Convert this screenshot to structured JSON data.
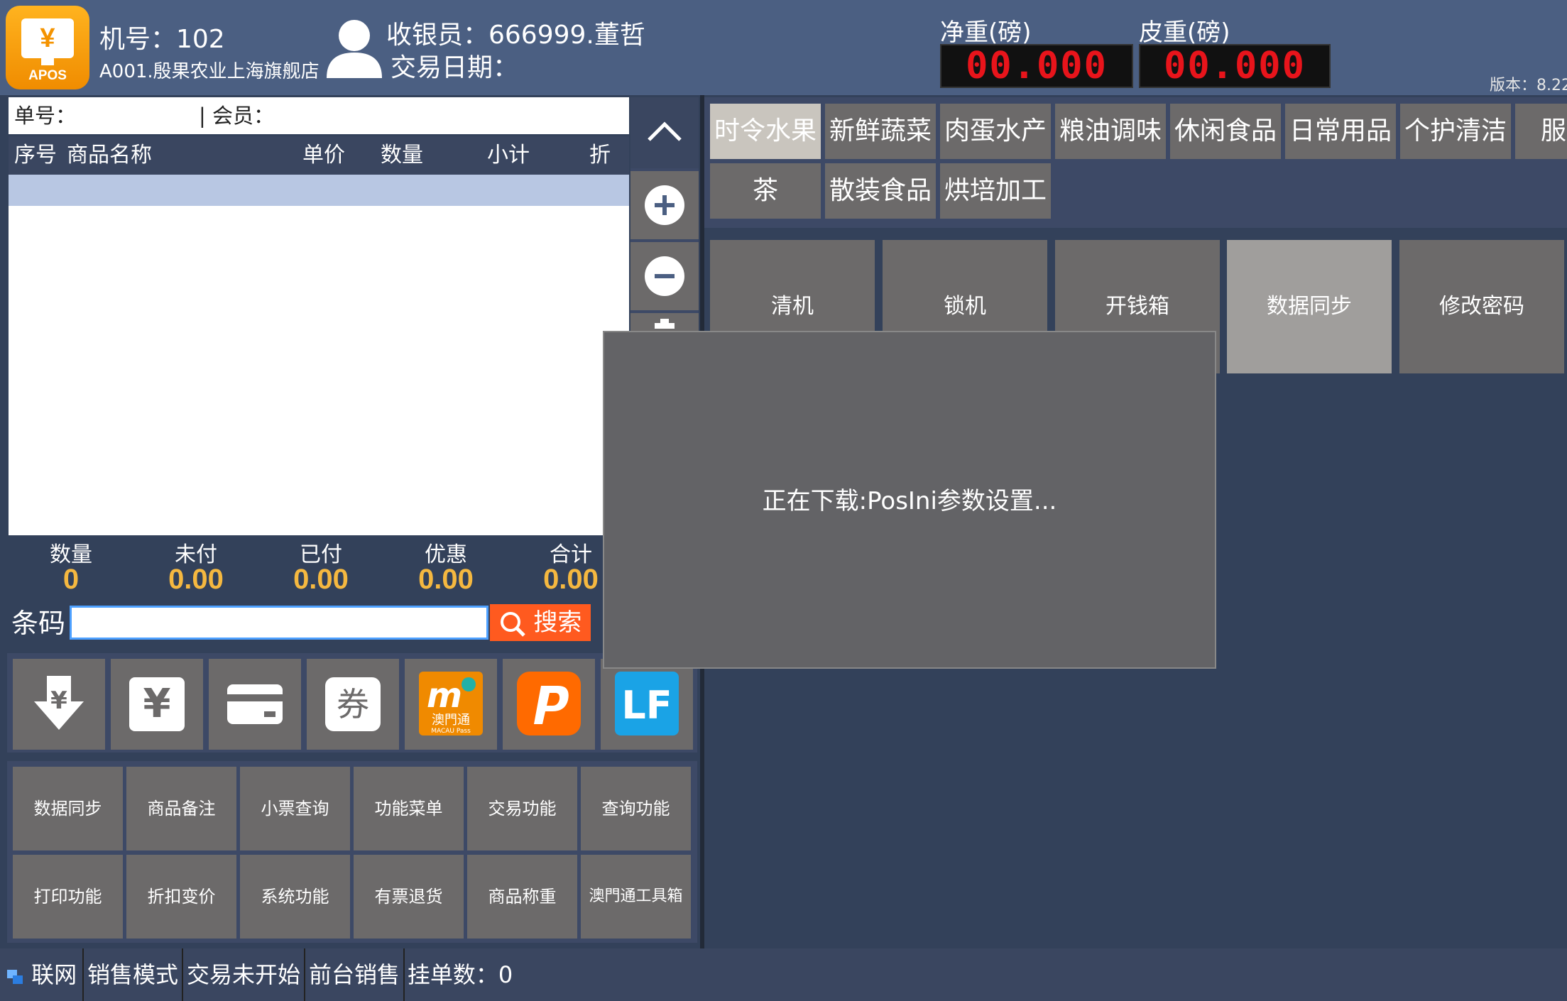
{
  "header": {
    "logo_text": "APOS",
    "logo_symbol": "¥",
    "machine_label": "机号：102",
    "store_label": "A001.殷果农业上海旗舰店",
    "cashier_label": "收银员：666999.董哲",
    "trade_date_label": "交易日期：",
    "net_weight_label": "净重(磅)",
    "tare_weight_label": "皮重(磅)",
    "net_weight_value": "00.000",
    "tare_weight_value": "00.000",
    "version_label": "版本：8.22"
  },
  "order": {
    "order_no_label": "单号：",
    "member_label": "| 会员："
  },
  "table": {
    "columns": [
      "序号",
      "商品名称",
      "单价",
      "数量",
      "小计",
      "折扣"
    ]
  },
  "summary": [
    {
      "label": "数量",
      "value": "0"
    },
    {
      "label": "未付",
      "value": "0.00"
    },
    {
      "label": "已付",
      "value": "0.00"
    },
    {
      "label": "优惠",
      "value": "0.00"
    },
    {
      "label": "合计",
      "value": "0.00"
    }
  ],
  "barcode": {
    "label": "条码",
    "value": "",
    "search_label": "搜索"
  },
  "payments": [
    "¥↓",
    "¥",
    "card",
    "券",
    "MACAU Pass",
    "P",
    "LF"
  ],
  "payment_texts": {
    "coupon": "券",
    "macau_main": "m",
    "macau_cn": "澳門通",
    "macau_en": "MACAU Pass",
    "lf": "LF"
  },
  "functions_row1": [
    "数据同步",
    "商品备注",
    "小票查询",
    "功能菜单",
    "交易功能",
    "查询功能"
  ],
  "functions_row2": [
    "打印功能",
    "折扣变价",
    "系统功能",
    "有票退货",
    "商品称重",
    "澳門通工具箱"
  ],
  "categories_row1": [
    "时令水果",
    "新鲜蔬菜",
    "肉蛋水产",
    "粮油调味",
    "休闲食品",
    "日常用品",
    "个护清洁",
    "服"
  ],
  "categories_row2": [
    "茶",
    "散装食品",
    "烘培加工"
  ],
  "function_tiles": [
    "清机",
    "锁机",
    "开钱箱",
    "数据同步",
    "修改密码"
  ],
  "dialog": {
    "message": "正在下载:PosIni参数设置..."
  },
  "status": {
    "network": "联网",
    "mode": "销售模式",
    "trade_status": "交易未开始",
    "sale_type": "前台销售",
    "held_orders": "挂单数：0"
  },
  "colors": {
    "header_bg": "#4b5f82",
    "body_bg": "#33415a",
    "button_gray": "#6c6a6a",
    "active_category": "#c9c5be",
    "accent_orange": "#ff5a1f",
    "amount_gold": "#f5b840"
  }
}
